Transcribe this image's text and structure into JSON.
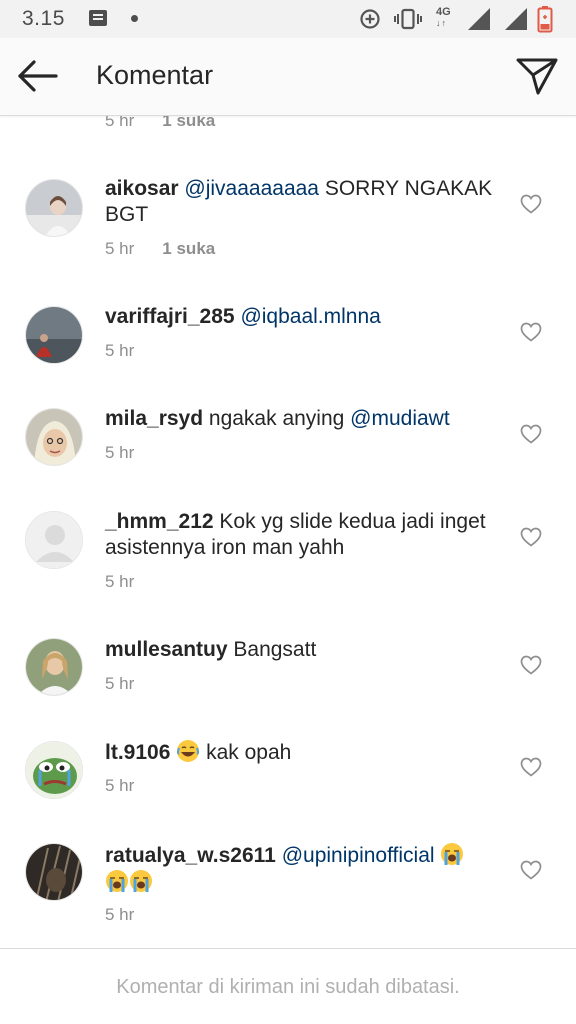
{
  "status_bar": {
    "time": "3.15",
    "network": "4G",
    "icons": [
      "message-icon",
      "notification-dot-icon",
      "data-saver-icon",
      "vibrate-icon",
      "signal-icon",
      "signal-icon",
      "battery-low-icon"
    ]
  },
  "header": {
    "title": "Komentar",
    "back_icon": "arrow-left-icon",
    "send_icon": "paper-plane-icon"
  },
  "previous_comment": {
    "time": "5 hr",
    "likes": "1 suka"
  },
  "comments": [
    {
      "username": "aikosar",
      "mention": "@jivaaaaaaaa",
      "text": " SORRY NGAKAK BGT",
      "time": "5 hr",
      "likes": "1 suka"
    },
    {
      "username": "variffajri_285",
      "mention": "@iqbaal.mlnna",
      "text": "",
      "time": "5 hr"
    },
    {
      "username": "mila_rsyd",
      "text": " ngakak anying ",
      "mention": "@mudiawt",
      "time": "5 hr"
    },
    {
      "username": "_hmm_212",
      "text": " Kok yg slide kedua jadi inget asistennya iron man yahh",
      "time": "5 hr"
    },
    {
      "username": "mullesantuy",
      "text": " Bangsatt",
      "time": "5 hr"
    },
    {
      "username": "lt.9106",
      "emoji": "face-with-tears-of-joy",
      "text": " kak opah",
      "time": "5 hr"
    },
    {
      "username": "ratualya_w.s2611",
      "mention": "@upinipinofficial",
      "emoji": "loudly-crying-face",
      "time": "5 hr"
    }
  ],
  "footer": {
    "text": "Komentar di kiriman ini sudah dibatasi."
  },
  "colors": {
    "mention": "#003569",
    "meta": "#8e8e8e",
    "text": "#262626",
    "header_bg": "#fafafa",
    "statusbar_bg": "#f2f2f2"
  }
}
